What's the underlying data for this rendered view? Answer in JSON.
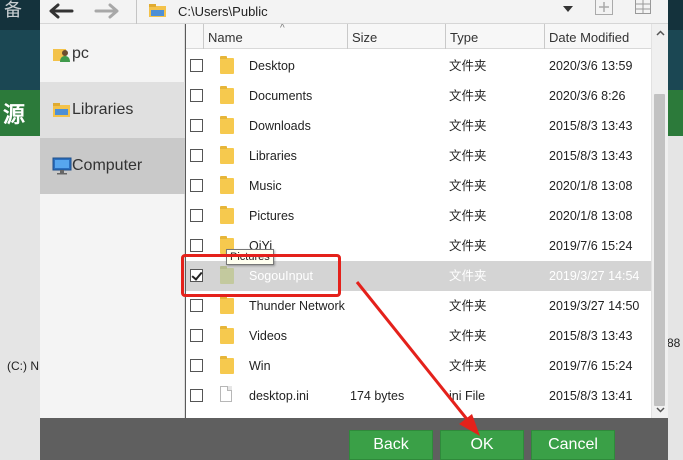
{
  "background": {
    "top_char": "备",
    "green_char": "源",
    "drive_label": "(C:) N",
    "edge_number": "88"
  },
  "toolbar": {
    "back_icon": "arrow-left-icon",
    "forward_icon": "arrow-right-icon",
    "path": "C:\\Users\\Public",
    "new_folder_icon": "plus-icon",
    "view_icon": "grid-icon"
  },
  "sidebar": {
    "items": [
      {
        "label": "pc",
        "icon": "user-folder-icon"
      },
      {
        "label": "Libraries",
        "icon": "libraries-icon"
      },
      {
        "label": "Computer",
        "icon": "computer-monitor-icon"
      }
    ]
  },
  "columns": [
    "Name",
    "Size",
    "Type",
    "Date Modified"
  ],
  "files": [
    {
      "name": "Desktop",
      "size": "",
      "type": "文件夹",
      "date": "2020/3/6 13:59",
      "kind": "folder",
      "checked": false,
      "selected": false
    },
    {
      "name": "Documents",
      "size": "",
      "type": "文件夹",
      "date": "2020/3/6 8:26",
      "kind": "folder",
      "checked": false,
      "selected": false
    },
    {
      "name": "Downloads",
      "size": "",
      "type": "文件夹",
      "date": "2015/8/3 13:43",
      "kind": "folder",
      "checked": false,
      "selected": false
    },
    {
      "name": "Libraries",
      "size": "",
      "type": "文件夹",
      "date": "2015/8/3 13:43",
      "kind": "folder",
      "checked": false,
      "selected": false
    },
    {
      "name": "Music",
      "size": "",
      "type": "文件夹",
      "date": "2020/1/8 13:08",
      "kind": "folder",
      "checked": false,
      "selected": false
    },
    {
      "name": "Pictures",
      "size": "",
      "type": "文件夹",
      "date": "2020/1/8 13:08",
      "kind": "folder",
      "checked": false,
      "selected": false
    },
    {
      "name": "QiYi",
      "size": "",
      "type": "文件夹",
      "date": "2019/7/6 15:24",
      "kind": "folder",
      "checked": false,
      "selected": false
    },
    {
      "name": "SogouInput",
      "size": "",
      "type": "文件夹",
      "date": "2019/3/27 14:54",
      "kind": "folder",
      "checked": true,
      "selected": true
    },
    {
      "name": "Thunder Network",
      "size": "",
      "type": "文件夹",
      "date": "2019/3/27 14:50",
      "kind": "folder",
      "checked": false,
      "selected": false
    },
    {
      "name": "Videos",
      "size": "",
      "type": "文件夹",
      "date": "2015/8/3 13:43",
      "kind": "folder",
      "checked": false,
      "selected": false
    },
    {
      "name": "Win",
      "size": "",
      "type": "文件夹",
      "date": "2019/7/6 15:24",
      "kind": "folder",
      "checked": false,
      "selected": false
    },
    {
      "name": "desktop.ini",
      "size": "174 bytes",
      "type": "ini File",
      "date": "2015/8/3 13:41",
      "kind": "file",
      "checked": false,
      "selected": false
    }
  ],
  "tooltip": "Pictures",
  "buttons": {
    "back": "Back",
    "ok": "OK",
    "cancel": "Cancel"
  },
  "colors": {
    "button_green": "#3aa047",
    "annotation_red": "#e4211b",
    "selected_row": "#d4d4d4"
  }
}
